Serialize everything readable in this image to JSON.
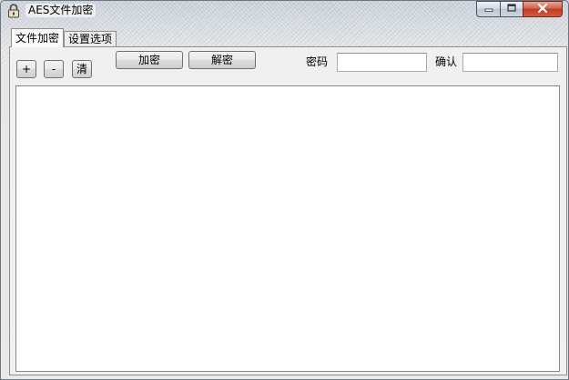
{
  "window": {
    "title": "AES文件加密"
  },
  "tabs": [
    {
      "label": "文件加密",
      "active": true
    },
    {
      "label": "设置选项",
      "active": false
    }
  ],
  "toolbar": {
    "add_label": "+",
    "remove_label": "-",
    "clear_label": "清",
    "encrypt_label": "加密",
    "decrypt_label": "解密",
    "password_label": "密码",
    "confirm_label": "确认",
    "password_value": "",
    "confirm_value": ""
  },
  "file_list": {
    "items": []
  },
  "icons": {
    "app": "lock-icon",
    "minimize": "minimize-icon",
    "maximize": "maximize-icon",
    "close": "close-icon"
  },
  "colors": {
    "close_button": "#c03a1f",
    "panel_background": "#f0f0f0"
  }
}
